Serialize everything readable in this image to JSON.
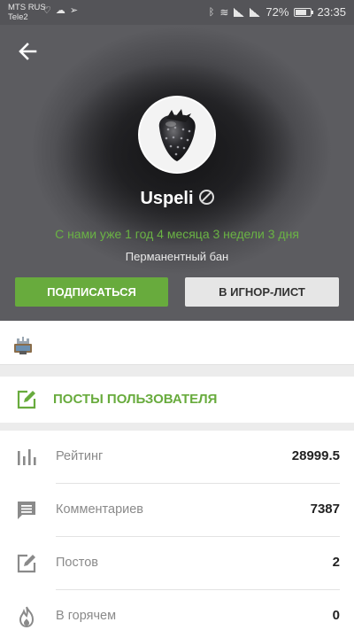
{
  "status_bar": {
    "carrier1": "MTS RUS",
    "carrier2": "Tele2",
    "battery_percent": "72%",
    "battery_level": 0.72,
    "time": "23:35"
  },
  "profile": {
    "username": "Uspeli",
    "member_since": "С нами уже 1 год 4 месяца 3 недели 3 дня",
    "ban_status": "Перманентный бан"
  },
  "actions": {
    "subscribe_label": "ПОДПИСАТЬСЯ",
    "ignore_label": "В ИГНОР-ЛИСТ"
  },
  "posts_link": {
    "label": "ПОСТЫ ПОЛЬЗОВАТЕЛЯ"
  },
  "stats": [
    {
      "icon": "rating-icon",
      "label": "Рейтинг",
      "value": "28999.5"
    },
    {
      "icon": "comments-icon",
      "label": "Комментариев",
      "value": "7387"
    },
    {
      "icon": "posts-icon",
      "label": "Постов",
      "value": "2"
    },
    {
      "icon": "hot-icon",
      "label": "В горячем",
      "value": "0"
    }
  ],
  "colors": {
    "accent_green": "#68ab3d",
    "member_since_green": "#6ab344"
  }
}
